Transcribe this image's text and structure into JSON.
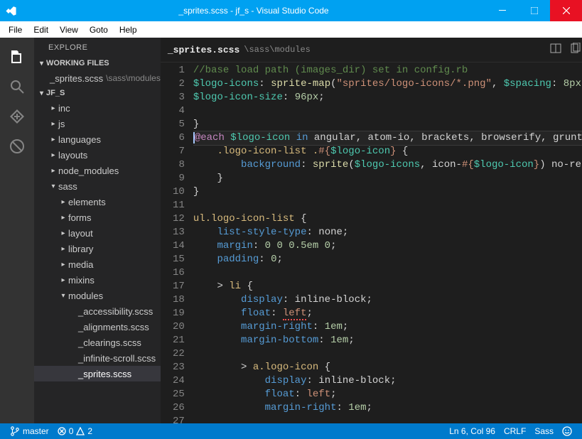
{
  "window": {
    "title": "_sprites.scss - jf_s - Visual Studio Code"
  },
  "menubar": {
    "items": [
      "File",
      "Edit",
      "View",
      "Goto",
      "Help"
    ]
  },
  "sidebar": {
    "title": "EXPLORE",
    "working_files": {
      "label": "WORKING FILES",
      "items": [
        {
          "name": "_sprites.scss",
          "path": "\\sass\\modules"
        }
      ]
    },
    "project": {
      "label": "JF_S",
      "tree": [
        {
          "depth": 1,
          "label": "inc",
          "expandable": true,
          "expanded": false
        },
        {
          "depth": 1,
          "label": "js",
          "expandable": true,
          "expanded": false
        },
        {
          "depth": 1,
          "label": "languages",
          "expandable": true,
          "expanded": false
        },
        {
          "depth": 1,
          "label": "layouts",
          "expandable": true,
          "expanded": false
        },
        {
          "depth": 1,
          "label": "node_modules",
          "expandable": true,
          "expanded": false
        },
        {
          "depth": 1,
          "label": "sass",
          "expandable": true,
          "expanded": true
        },
        {
          "depth": 2,
          "label": "elements",
          "expandable": true,
          "expanded": false
        },
        {
          "depth": 2,
          "label": "forms",
          "expandable": true,
          "expanded": false
        },
        {
          "depth": 2,
          "label": "layout",
          "expandable": true,
          "expanded": false
        },
        {
          "depth": 2,
          "label": "library",
          "expandable": true,
          "expanded": false
        },
        {
          "depth": 2,
          "label": "media",
          "expandable": true,
          "expanded": false
        },
        {
          "depth": 2,
          "label": "mixins",
          "expandable": true,
          "expanded": false
        },
        {
          "depth": 2,
          "label": "modules",
          "expandable": true,
          "expanded": true
        },
        {
          "depth": 3,
          "label": "_accessibility.scss",
          "expandable": false
        },
        {
          "depth": 3,
          "label": "_alignments.scss",
          "expandable": false
        },
        {
          "depth": 3,
          "label": "_clearings.scss",
          "expandable": false
        },
        {
          "depth": 3,
          "label": "_infinite-scroll.scss",
          "expandable": false
        },
        {
          "depth": 3,
          "label": "_sprites.scss",
          "expandable": false,
          "selected": true
        }
      ]
    }
  },
  "tabs": {
    "name": "_sprites.scss",
    "path": "\\sass\\modules"
  },
  "editor": {
    "first_line": 1,
    "line_count": 27,
    "current_line": 6,
    "lines": {
      "l1": "//base load path (images_dir) set in config.rb",
      "l2a": "$logo-icons",
      "l2b": ": ",
      "l2c": "sprite-map",
      "l2d": "(",
      "l2e": "\"sprites/logo-icons/*.png\"",
      "l2f": ", ",
      "l2g": "$spacing",
      "l2h": ": ",
      "l2i": "8px",
      "l2j": ");",
      "l3a": "$logo-icon-size",
      "l3b": ": ",
      "l3c": "96px",
      "l3d": ";",
      "l5a": "}",
      "l6a": "@each",
      "l6b": " ",
      "l6c": "$logo-icon",
      "l6d": " ",
      "l6e": "in",
      "l6f": " angular, atom-io, brackets, browserify, grunt, gu",
      "l7a": "    .logo-icon-list ",
      "l7b": ".",
      "l7c": "#{",
      "l7d": "$logo-icon",
      "l7e": "}",
      "l7f": " {",
      "l8a": "        background",
      "l8b": ": ",
      "l8c": "sprite",
      "l8d": "(",
      "l8e": "$logo-icons",
      "l8f": ", icon-",
      "l8g": "#{",
      "l8h": "$logo-icon",
      "l8i": "}",
      "l8j": ") no-repeat",
      "l9a": "    }",
      "l10a": "}",
      "l12a": "ul.logo-icon-list",
      "l12b": " {",
      "l13a": "    list-style-type",
      "l13b": ": none;",
      "l14a": "    margin",
      "l14b": ": ",
      "l14c": "0 0 0.5em 0",
      "l14d": ";",
      "l15a": "    padding",
      "l15b": ": ",
      "l15c": "0",
      "l15d": ";",
      "l17a": "    > ",
      "l17b": "li",
      "l17c": " {",
      "l18a": "        display",
      "l18b": ": inline-block;",
      "l19a": "        float",
      "l19b": ": ",
      "l19c": "left",
      "l19d": ";",
      "l20a": "        margin-right",
      "l20b": ": ",
      "l20c": "1em",
      "l20d": ";",
      "l21a": "        margin-bottom",
      "l21b": ": ",
      "l21c": "1em",
      "l21d": ";",
      "l23a": "        > ",
      "l23b": "a.logo-icon",
      "l23c": " {",
      "l24a": "            display",
      "l24b": ": inline-block;",
      "l25a": "            float",
      "l25b": ": ",
      "l25c": "left",
      "l25d": ";",
      "l26a": "            margin-right",
      "l26b": ": ",
      "l26c": "1em",
      "l26d": ";"
    }
  },
  "statusbar": {
    "branch_label": "master",
    "errors": "0",
    "warnings": "2",
    "lncol": "Ln 6, Col 96",
    "eol": "CRLF",
    "language": "Sass"
  }
}
